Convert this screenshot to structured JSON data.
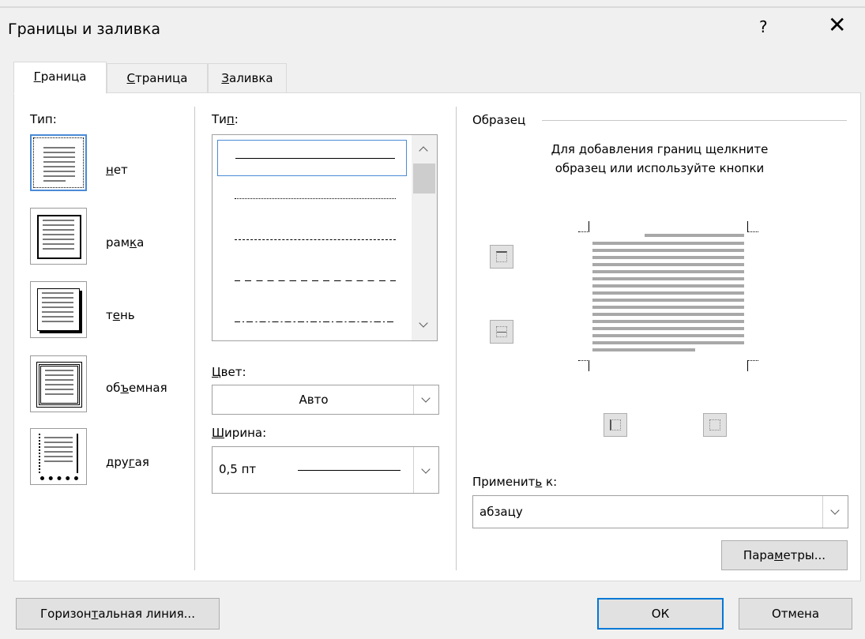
{
  "window": {
    "title": "Границы и заливка",
    "help": "?",
    "close": "✕"
  },
  "tabs": [
    {
      "label": "Граница",
      "mnemonic": "Г",
      "rest": "раница"
    },
    {
      "label": "Страница",
      "mnemonic": "С",
      "rest": "траница"
    },
    {
      "label": "Заливка",
      "mnemonic": "З",
      "rest": "аливка"
    }
  ],
  "setting": {
    "title": "Тип:",
    "presets": [
      {
        "label": "нет",
        "pre": "",
        "mn": "н",
        "post": "ет"
      },
      {
        "label": "рамка",
        "pre": "рам",
        "mn": "к",
        "post": "а"
      },
      {
        "label": "тень",
        "pre": "т",
        "mn": "е",
        "post": "нь"
      },
      {
        "label": "объемная",
        "pre": "об",
        "mn": "ъ",
        "post": "емная"
      },
      {
        "label": "другая",
        "pre": "дру",
        "mn": "г",
        "post": "ая"
      }
    ],
    "selected": "нет"
  },
  "style": {
    "title": "Тип:",
    "title_pre": "Ти",
    "title_mn": "п",
    "title_post": ":",
    "lines": [
      "solid",
      "dotted",
      "dashed-fine",
      "dashed",
      "dash-dot"
    ],
    "selected_index": 0
  },
  "color": {
    "label_mn": "Ц",
    "label_rest": "вет:",
    "value": "Авто"
  },
  "width": {
    "label_mn": "Ш",
    "label_rest": "ирина:",
    "value": "0,5 пт"
  },
  "preview": {
    "title": "Образец",
    "hint_line1": "Для добавления границ щелкните",
    "hint_line2": "образец или используйте кнопки"
  },
  "apply_to": {
    "label_pre": "Применит",
    "label_mn": "ь",
    "label_post": " к:",
    "value": "абзацу"
  },
  "buttons": {
    "options_pre": "Пара",
    "options_mn": "м",
    "options_post": "етры...",
    "hline_pre": "Горизон",
    "hline_mn": "т",
    "hline_post": "альная линия...",
    "ok": "ОК",
    "cancel": "Отмена"
  },
  "colors": {
    "accent": "#0078d7",
    "selection": "#4a8bd6",
    "panel": "#ffffff",
    "chrome": "#f0f0f0"
  }
}
